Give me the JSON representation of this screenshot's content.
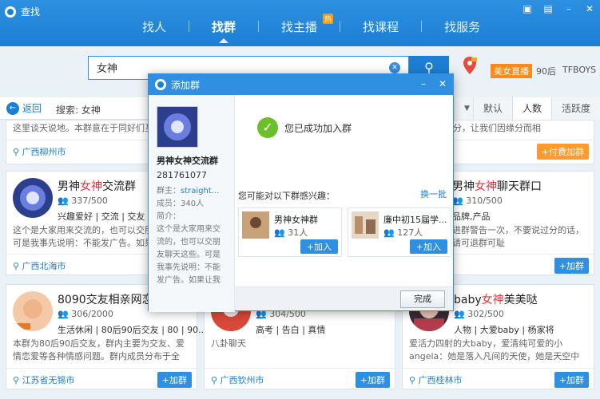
{
  "window": {
    "title": "查找"
  },
  "nav": {
    "items": [
      {
        "label": "找人"
      },
      {
        "label": "找群"
      },
      {
        "label": "找主播",
        "badge": "热"
      },
      {
        "label": "找课程"
      },
      {
        "label": "找服务"
      }
    ],
    "active": "找群"
  },
  "search": {
    "value": "女神",
    "hot_tags": [
      "美女直播",
      "90后",
      "TFBOYS"
    ]
  },
  "filter": {
    "back_label": "返回",
    "search_label": "搜索: 女神",
    "sort_tabs": [
      "默认",
      "人数",
      "活跃度"
    ],
    "active_sort": "人数"
  },
  "cards": [
    {
      "name": "",
      "count": "",
      "tags": "",
      "desc": "这里谈天说地。本群意在于同好们互相",
      "loc": "广西柳州市",
      "join": ""
    },
    {
      "name": "",
      "count": "",
      "tags": "",
      "desc": "相聚就是缘分，让我们因缘分而相",
      "loc": "",
      "join": "+付费加群"
    },
    {
      "name_prefix": "男神",
      "name_hl": "女神",
      "name_suffix": "交流群",
      "count": "337/500",
      "tags": "兴趣爱好 | 交流 | 交友",
      "desc": "这个是大家用来交流的，也可以交朋友聊天，可是我事先说明：不能发广告。如果让",
      "loc": "广西北海市",
      "join": ""
    },
    {
      "name_prefix": "男神",
      "name_hl": "女神",
      "name_suffix": "聊天群口",
      "count": "310/500",
      "tags": "品牌,产品",
      "desc": "进群警告一次，不要说过分的话，请可退群可耻",
      "loc": "",
      "join": "+加群"
    },
    {
      "name_prefix": "8090交友相亲网恋",
      "name_hl": "",
      "name_suffix": "",
      "count": "306/2000",
      "tags": "生活休闲 | 80后90后交友 | 80 | 90...",
      "desc": "本群为80后90后交友，群内主要为交友、爱情恋爱等各种情感问题。群内成员分布于全国...",
      "loc": "江苏省无锡市",
      "join": "+加群"
    },
    {
      "name_prefix": "",
      "name_hl": "",
      "name_suffix": "",
      "count": "304/500",
      "tags": "高考 | 告白 | 真情",
      "desc": "八卦聊天",
      "loc": "广西钦州市",
      "join": "+加群"
    },
    {
      "name_prefix": "baby",
      "name_hl": "女神",
      "name_suffix": "美美哒",
      "count": "302/500",
      "tags": "人物 | 大爱baby | 杨家将",
      "desc": "爱活力四射的大baby，爱清纯可爱的小angela：她是落入凡间的天使，她是天空中最璀璨夺目的一...",
      "loc": "广西桂林市",
      "join": "+加群"
    }
  ],
  "dialog": {
    "title": "添加群",
    "group": {
      "name": "男神女神交流群",
      "id": "281761077",
      "owner_label": "群主：",
      "owner": "straight...",
      "members": "成员：340人",
      "intro_label": "简介：",
      "intro": "这个是大家用来交流的，也可以交朋友聊天这些。可是我事先说明：不能发广告。如果让我"
    },
    "success_text": "您已成功加入群",
    "suggest_label": "您可能对以下群感兴趣：",
    "swap_label": "换一批",
    "suggestions": [
      {
        "name": "男神女神群",
        "count": "31人",
        "join": "+加入"
      },
      {
        "name": "廉中初15届学...",
        "count": "127人",
        "join": "+加入"
      }
    ],
    "done_label": "完成"
  },
  "colors": {
    "brand": "#1d7fd4",
    "highlight": "#e5333c",
    "pay": "#ff9a2e",
    "success": "#6cbf2a"
  }
}
